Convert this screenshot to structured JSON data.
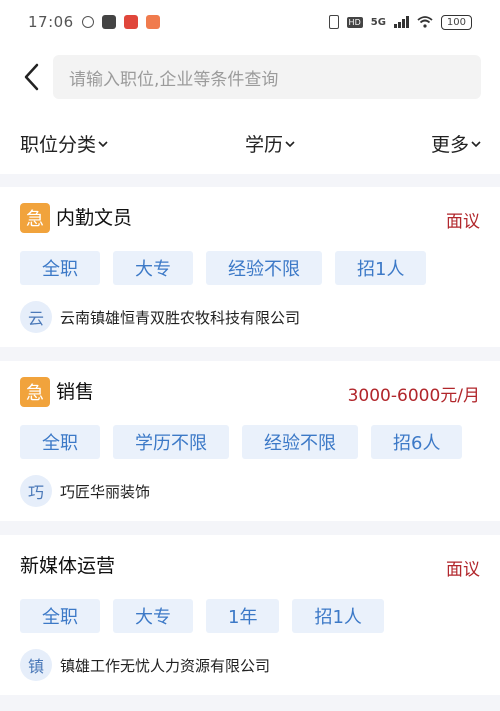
{
  "status_bar": {
    "time": "17:06",
    "network": "5G",
    "battery": "100"
  },
  "search": {
    "placeholder": "请输入职位,企业等条件查询"
  },
  "filters": [
    {
      "label": "职位分类"
    },
    {
      "label": "学历"
    },
    {
      "label": "更多"
    }
  ],
  "jobs": [
    {
      "urgent_label": "急",
      "title": "内勤文员",
      "salary": "面议",
      "tags": [
        "全职",
        "大专",
        "经验不限",
        "招1人"
      ],
      "company_initial": "云",
      "company": "云南镇雄恒青双胜农牧科技有限公司"
    },
    {
      "urgent_label": "急",
      "title": "销售",
      "salary": "3000-6000元/月",
      "tags": [
        "全职",
        "学历不限",
        "经验不限",
        "招6人"
      ],
      "company_initial": "巧",
      "company": "巧匠华丽装饰"
    },
    {
      "title": "新媒体运营",
      "salary": "面议",
      "tags": [
        "全职",
        "大专",
        "1年",
        "招1人"
      ],
      "company_initial": "镇",
      "company": "镇雄工作无忧人力资源有限公司"
    }
  ],
  "colors": {
    "accent_blue": "#3c79c7",
    "tag_bg": "#eaf1fb",
    "salary_red": "#b1262b",
    "urgent_orange": "#f1a33c"
  }
}
